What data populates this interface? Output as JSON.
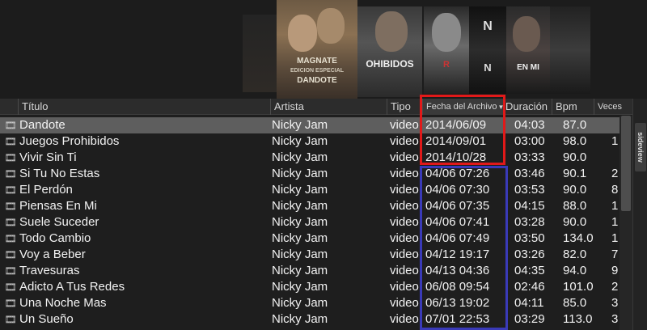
{
  "coverflow": {
    "covers": [
      {
        "id": "main",
        "lines": [
          "MAGNATE",
          "EDICION ESPECIAL",
          "DANDOTE"
        ]
      },
      {
        "id": "2",
        "lines": [
          "OHIBIDOS"
        ]
      },
      {
        "id": "3",
        "lines": [
          "R"
        ]
      },
      {
        "id": "4",
        "lines": [
          "N",
          "N"
        ]
      },
      {
        "id": "5",
        "lines": [
          "EN MI"
        ]
      },
      {
        "id": "6",
        "lines": [
          ""
        ]
      }
    ]
  },
  "columns": {
    "title": "Título",
    "artist": "Artista",
    "type": "Tipo",
    "date": "Fecha del Archivo",
    "duration": "Duración",
    "bpm": "Bpm",
    "plays": "Veces"
  },
  "icons": {
    "track": "film-icon",
    "sort": "sort-desc-icon"
  },
  "tracks": [
    {
      "title": "Dandote",
      "artist": "Nicky Jam",
      "type": "video",
      "date": "2014/06/09",
      "duration": "04:03",
      "bpm": "87.0",
      "plays": "",
      "selected": true
    },
    {
      "title": "Juegos Prohibidos",
      "artist": "Nicky Jam",
      "type": "video",
      "date": "2014/09/01",
      "duration": "03:00",
      "bpm": "98.0",
      "plays": "1"
    },
    {
      "title": "Vivir Sin Ti",
      "artist": "Nicky Jam",
      "type": "video",
      "date": "2014/10/28",
      "duration": "03:33",
      "bpm": "90.0",
      "plays": ""
    },
    {
      "title": "Si Tu No Estas",
      "artist": "Nicky Jam",
      "type": "video",
      "date": "04/06 07:26",
      "duration": "03:46",
      "bpm": "90.1",
      "plays": "2"
    },
    {
      "title": "El Perdón",
      "artist": "Nicky Jam",
      "type": "video",
      "date": "04/06 07:30",
      "duration": "03:53",
      "bpm": "90.0",
      "plays": "8"
    },
    {
      "title": "Piensas En Mi",
      "artist": "Nicky Jam",
      "type": "video",
      "date": "04/06 07:35",
      "duration": "04:15",
      "bpm": "88.0",
      "plays": "1"
    },
    {
      "title": "Suele Suceder",
      "artist": "Nicky Jam",
      "type": "video",
      "date": "04/06 07:41",
      "duration": "03:28",
      "bpm": "90.0",
      "plays": "1"
    },
    {
      "title": "Todo Cambio",
      "artist": "Nicky Jam",
      "type": "video",
      "date": "04/06 07:49",
      "duration": "03:50",
      "bpm": "134.0",
      "plays": "1"
    },
    {
      "title": "Voy a Beber",
      "artist": "Nicky Jam",
      "type": "video",
      "date": "04/12 19:17",
      "duration": "03:26",
      "bpm": "82.0",
      "plays": "7"
    },
    {
      "title": "Travesuras",
      "artist": "Nicky Jam",
      "type": "video",
      "date": "04/13 04:36",
      "duration": "04:35",
      "bpm": "94.0",
      "plays": "9"
    },
    {
      "title": "Adicto A Tus Redes",
      "artist": "Nicky Jam",
      "type": "video",
      "date": "06/08 09:54",
      "duration": "02:46",
      "bpm": "101.0",
      "plays": "2"
    },
    {
      "title": "Una Noche Mas",
      "artist": "Nicky Jam",
      "type": "video",
      "date": "06/13 19:02",
      "duration": "04:11",
      "bpm": "85.0",
      "plays": "3"
    },
    {
      "title": "Un Sueño",
      "artist": "Nicky Jam",
      "type": "video",
      "date": "07/01 22:53",
      "duration": "03:29",
      "bpm": "113.0",
      "plays": "3"
    }
  ],
  "sideview": {
    "label": "sideview"
  },
  "colors": {
    "annotation_red": "#e11919",
    "annotation_blue": "#3a3ab8",
    "selected_row": "#5e5e5e"
  }
}
